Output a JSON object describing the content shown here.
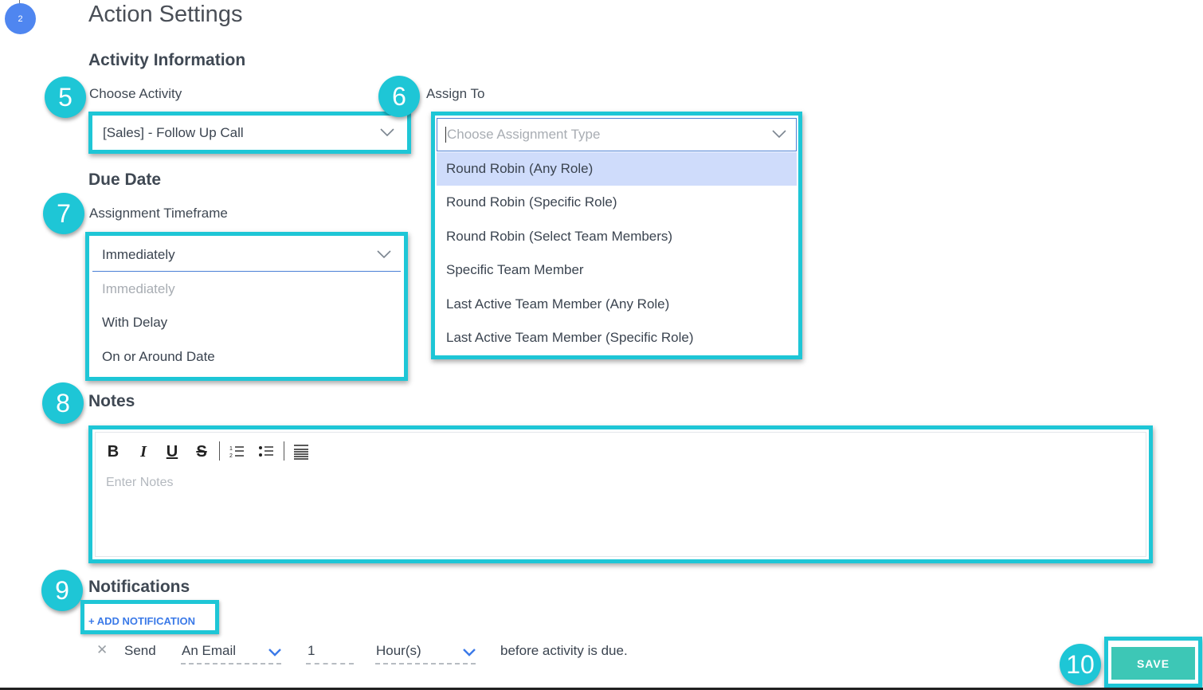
{
  "header": {
    "step_number": "2",
    "title": "Action Settings"
  },
  "activity": {
    "section_title": "Activity Information",
    "choose_label": "Choose Activity",
    "choose_value": "[Sales] - Follow Up Call",
    "assign_label": "Assign To",
    "assign_placeholder": "Choose Assignment Type",
    "assign_options": [
      "Round Robin (Any Role)",
      "Round Robin (Specific Role)",
      "Round Robin (Select Team Members)",
      "Specific Team Member",
      "Last Active Team Member (Any Role)",
      "Last Active Team Member (Specific Role)"
    ]
  },
  "due_date": {
    "section_title": "Due Date",
    "timeframe_label": "Assignment Timeframe",
    "timeframe_value": "Immediately",
    "timeframe_options": [
      "Immediately",
      "With Delay",
      "On or Around Date"
    ]
  },
  "notes": {
    "section_title": "Notes",
    "placeholder": "Enter Notes",
    "toolbar": {
      "bold": "B",
      "italic": "I",
      "underline": "U",
      "strike": "S"
    }
  },
  "notifications": {
    "section_title": "Notifications",
    "add_label": "+ ADD NOTIFICATION",
    "row": {
      "remove": "✕",
      "send_label": "Send",
      "method": "An Email",
      "amount": "1",
      "unit": "Hour(s)",
      "suffix": "before activity is due."
    }
  },
  "save_label": "SAVE",
  "callouts": [
    "5",
    "6",
    "7",
    "8",
    "9",
    "10"
  ],
  "colors": {
    "accent": "#1ec6d6",
    "save": "#3dc7b6",
    "link": "#3b7ae8",
    "highlight_row": "#cfdcfb"
  }
}
